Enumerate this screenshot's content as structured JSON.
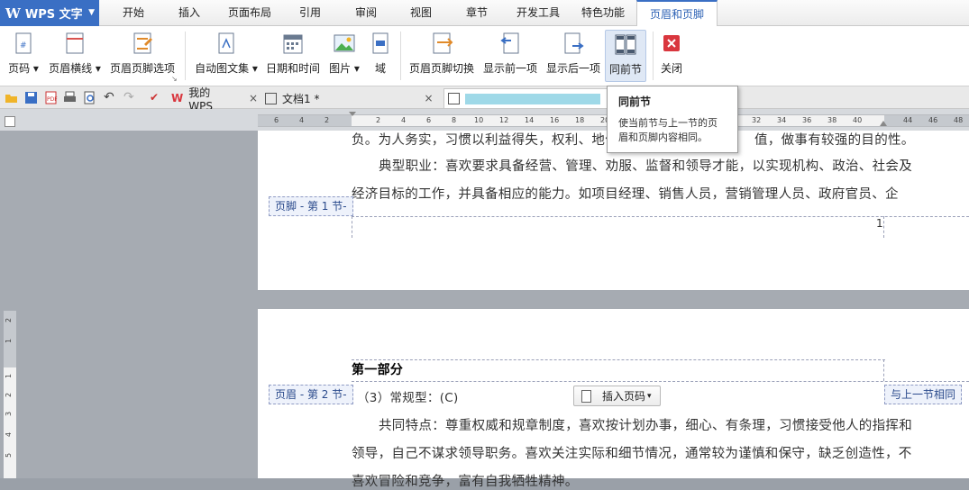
{
  "app": {
    "name": "WPS 文字"
  },
  "menu": {
    "tabs": [
      "开始",
      "插入",
      "页面布局",
      "引用",
      "审阅",
      "视图",
      "章节",
      "开发工具",
      "特色功能",
      "页眉和页脚"
    ]
  },
  "ribbon": {
    "page_number": "页码",
    "header_line": "页眉横线",
    "hf_options": "页眉页脚选项",
    "autotext": "自动图文集",
    "datetime": "日期和时间",
    "picture": "图片",
    "field": "域",
    "hf_switch": "页眉页脚切换",
    "show_prev": "显示前一项",
    "show_next": "显示后一项",
    "same_as_prev": "同前节",
    "close": "关闭"
  },
  "tabs_bar": {
    "my_wps": "我的WPS",
    "doc1": "文档1 *"
  },
  "tooltip": {
    "title": "同前节",
    "desc": "使当前节与上一节的页眉和页脚内容相同。"
  },
  "ruler": {
    "h_ticks": [
      "6",
      "4",
      "2",
      "2",
      "4",
      "6",
      "8",
      "10",
      "12",
      "14",
      "16",
      "18",
      "20",
      "32",
      "34",
      "36",
      "38",
      "40",
      "44",
      "46",
      "48"
    ],
    "v_ticks": [
      "2",
      "1",
      "1",
      "2",
      "3",
      "4",
      "5"
    ]
  },
  "page1": {
    "line1": "负。为人务实，习惯以利益得失，权利、地位、",
    "line1_end": "值，做事有较强的目的性。",
    "line2": "典型职业：喜欢要求具备经营、管理、劝服、监督和领导才能，以实现机构、政治、社会及",
    "line3": "经济目标的工作，并具备相应的能力。如项目经理、销售人员，营销管理人员、政府官员、企",
    "footer_tag": "页脚 - 第 1 节-",
    "page_num": "1"
  },
  "page2": {
    "heading": "第一部分",
    "header_tag": "页眉 - 第 2 节-",
    "link_tag": "与上一节相同",
    "insert_btn": "插入页码",
    "line1": "（3）常规型：(C)",
    "line2": "共同特点：尊重权威和规章制度，喜欢按计划办事，细心、有条理，习惯接受他人的指挥和",
    "line3": "领导，自己不谋求领导职务。喜欢关注实际和细节情况，通常较为谨慎和保守，缺乏创造性，不",
    "line4": "喜欢冒险和竞争，富有自我牺牲精神。"
  },
  "colors": {
    "accent": "#3a6fc4",
    "tab_active_text": "#2d62b5",
    "close_red": "#d9363e"
  }
}
